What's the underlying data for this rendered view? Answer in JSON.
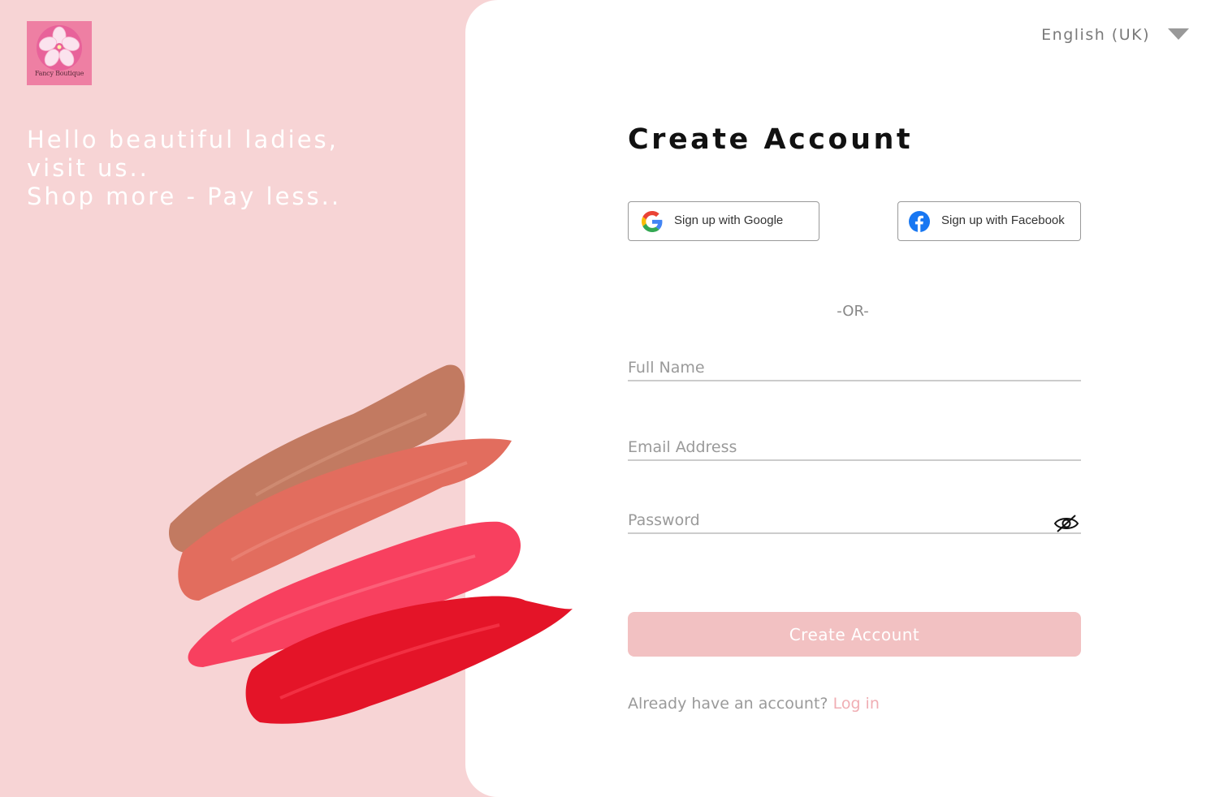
{
  "brand": {
    "name": "Fancy Boutique"
  },
  "hero": {
    "line1": "Hello beautiful ladies, visit us..",
    "line2": "Shop more - Pay less.."
  },
  "language": {
    "selected": "English (UK)"
  },
  "form": {
    "title": "Create Account",
    "google_label": "Sign up with Google",
    "facebook_label": "Sign up with Facebook",
    "separator": "-OR-",
    "full_name_placeholder": "Full Name",
    "email_placeholder": "Email Address",
    "password_placeholder": "Password",
    "submit_label": "Create Account",
    "login_prompt": "Already have an account?",
    "login_link": "Log in"
  },
  "colors": {
    "left_background": "#f7d4d5",
    "submit_button": "#f2c1c2",
    "link": "#f0aeb4",
    "facebook_blue": "#1877f2"
  },
  "icons": {
    "google": "google-icon",
    "facebook": "facebook-icon",
    "password_toggle": "eye-slash-icon",
    "language_dropdown": "triangle-down-icon"
  }
}
